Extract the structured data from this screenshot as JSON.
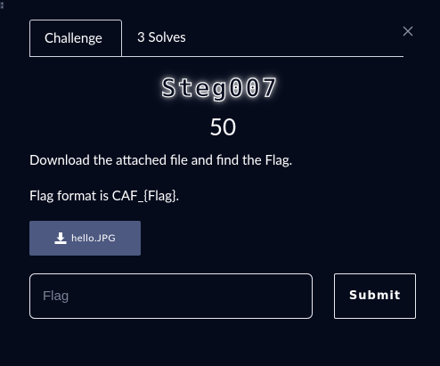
{
  "tabs": [
    {
      "label": "Challenge",
      "active": true
    },
    {
      "label": "3 Solves",
      "active": false
    }
  ],
  "corner_glyph": "⁑",
  "challenge": {
    "name": "Steg007",
    "points": "50",
    "description": "Download the attached file and find the Flag.",
    "flag_format": "Flag format is CAF_{Flag}."
  },
  "file": {
    "label": "hello.JPG",
    "icon": "download-icon"
  },
  "form": {
    "placeholder": "Flag",
    "value": "",
    "submit_label": "Submit"
  },
  "colors": {
    "background": "#060b1c",
    "file_button": "#4d5980",
    "border": "#e8eaf0",
    "text": "#ffffff"
  }
}
